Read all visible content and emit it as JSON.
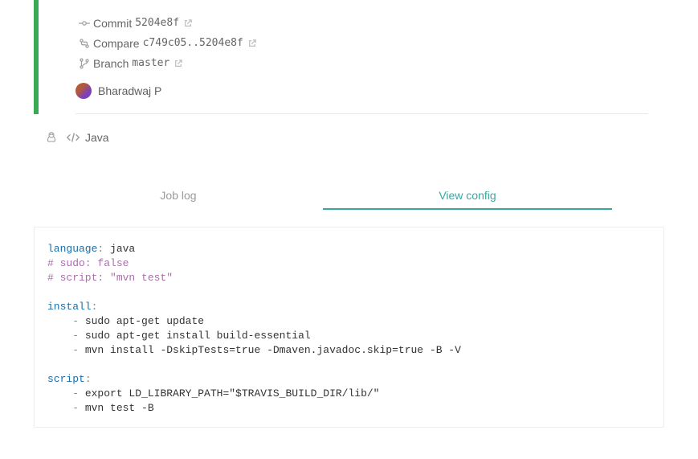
{
  "commit": {
    "label": "Commit",
    "hash": "5204e8f"
  },
  "compare": {
    "label": "Compare",
    "range": "c749c05..5204e8f"
  },
  "branch": {
    "label": "Branch",
    "name": "master"
  },
  "author": {
    "name": "Bharadwaj P"
  },
  "env": {
    "language": "Java"
  },
  "tabs": {
    "log": "Job log",
    "config": "View config"
  },
  "config": {
    "language_key": "language",
    "language_value": "java",
    "comment_sudo": "# sudo: false",
    "comment_script": "# script: \"mvn test\"",
    "install_key": "install",
    "install_lines": [
      "sudo apt-get update",
      "sudo apt-get install build-essential",
      "mvn install -DskipTests=true -Dmaven.javadoc.skip=true -B -V"
    ],
    "script_key": "script",
    "script_lines": [
      "export LD_LIBRARY_PATH=\"$TRAVIS_BUILD_DIR/lib/\"",
      "mvn test -B"
    ]
  }
}
